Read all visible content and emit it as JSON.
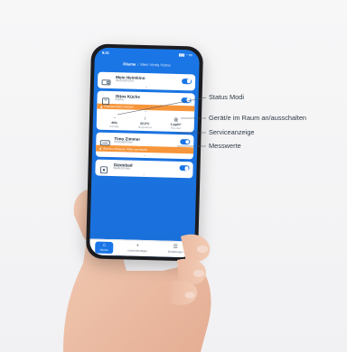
{
  "phone": {
    "status_time": "9:41",
    "status_icons": "▮▮▮ ◔ ▭",
    "breadcrumb": {
      "home": "Räume",
      "sep": "/",
      "sub": "Mein Venta Home"
    },
    "cards": [
      {
        "title": "Mein Heimkino",
        "room": "Wohnzimmer",
        "icon": "projector-icon",
        "on": true,
        "service": "",
        "expanded": false
      },
      {
        "title": "Ottos Küche",
        "room": "Küche",
        "icon": "humidifier-icon",
        "on": true,
        "service": "Filterwechsel erinnert",
        "expanded": true,
        "measurements": [
          {
            "icon": "humidity-icon",
            "glyph": "💧",
            "value": "45%",
            "label": "Humidity"
          },
          {
            "icon": "thermometer-icon",
            "glyph": "🌡",
            "value": "22,0°C",
            "label": "Temperature"
          },
          {
            "icon": "particles-icon",
            "glyph": "▦",
            "value": "1 µg/m³",
            "label": "Fine dust"
          }
        ]
      },
      {
        "title": "Timo Zimmer",
        "room": "Schlafzimmer",
        "icon": "purifier-icon",
        "on": true,
        "service": "Service-Hinweis: Filter wechseln",
        "expanded": false
      },
      {
        "title": "Gästebad",
        "room": "Badezimmer",
        "icon": "humidifier-icon",
        "on": true,
        "service": "",
        "expanded": false
      }
    ],
    "tabs": [
      {
        "name": "tab-home",
        "glyph": "⌂",
        "label": "Räume",
        "active": true
      },
      {
        "name": "tab-add-device",
        "glyph": "+",
        "label": "Gerät hinzufügen",
        "active": false
      },
      {
        "name": "tab-settings",
        "glyph": "☰",
        "label": "Einstellungen",
        "active": false
      }
    ]
  },
  "callouts": {
    "status": "Status Modi",
    "toggle": "Gerät/e im Raum an/ausschalten",
    "service": "Serviceanzeige",
    "measure": "Messwerte"
  },
  "colors": {
    "primary": "#1a76e6",
    "service": "#f7953a",
    "card": "#ffffff",
    "text": "#1d2b3a"
  }
}
